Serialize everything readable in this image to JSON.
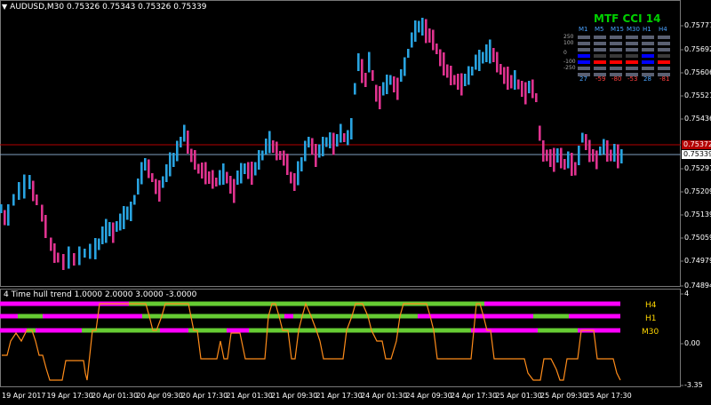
{
  "window": {
    "symbol_header": "AUDUSD,M30  0.75326 0.75343 0.75326 0.75339",
    "indicator_header": "4 Time hull trend 1.0000 2.0000 3.0000 -3.0000"
  },
  "price_axis": {
    "labels": [
      "0.75777",
      "0.75692",
      "0.75606",
      "0.75521",
      "0.75436",
      "0.75291",
      "0.75209",
      "0.75139",
      "0.75059",
      "0.74979",
      "0.74894"
    ],
    "current_price": "0.75339",
    "red_line_price": "0.75372"
  },
  "indicator_axis": {
    "labels": [
      "4",
      "0.00",
      "-3.35"
    ]
  },
  "hull_labels": {
    "h4": "H4",
    "h1": "H1",
    "m30": "M30"
  },
  "time_axis": {
    "labels": [
      "19 Apr 2017",
      "19 Apr 17:30",
      "20 Apr 01:30",
      "20 Apr 09:30",
      "20 Apr 17:30",
      "21 Apr 01:30",
      "21 Apr 09:30",
      "21 Apr 17:30",
      "24 Apr 01:30",
      "24 Apr 09:30",
      "24 Apr 17:30",
      "25 Apr 01:30",
      "25 Apr 09:30",
      "25 Apr 17:30"
    ]
  },
  "mtf_cci": {
    "title": "MTF CCI  14",
    "timeframes": [
      "M1",
      "M5",
      "M15",
      "M30",
      "H1",
      "H4"
    ],
    "levels": [
      "250",
      "100",
      "0",
      "-100",
      "-250"
    ],
    "values": [
      "27",
      "-59",
      "-80",
      "-53",
      "28",
      "-81"
    ],
    "value_colors": [
      "#4aa3ff",
      "#ff4040",
      "#ff4040",
      "#ff4040",
      "#4aa3ff",
      "#ff4040"
    ]
  },
  "colors": {
    "bull": "#29a3e0",
    "bear": "#e0338f",
    "magenta": "#ff00ff",
    "green": "#66cc33",
    "orange": "#ff8c1a",
    "label_yellow": "#ffd700",
    "current_line": "#7f9fbf",
    "red_line": "#b40000"
  }
}
